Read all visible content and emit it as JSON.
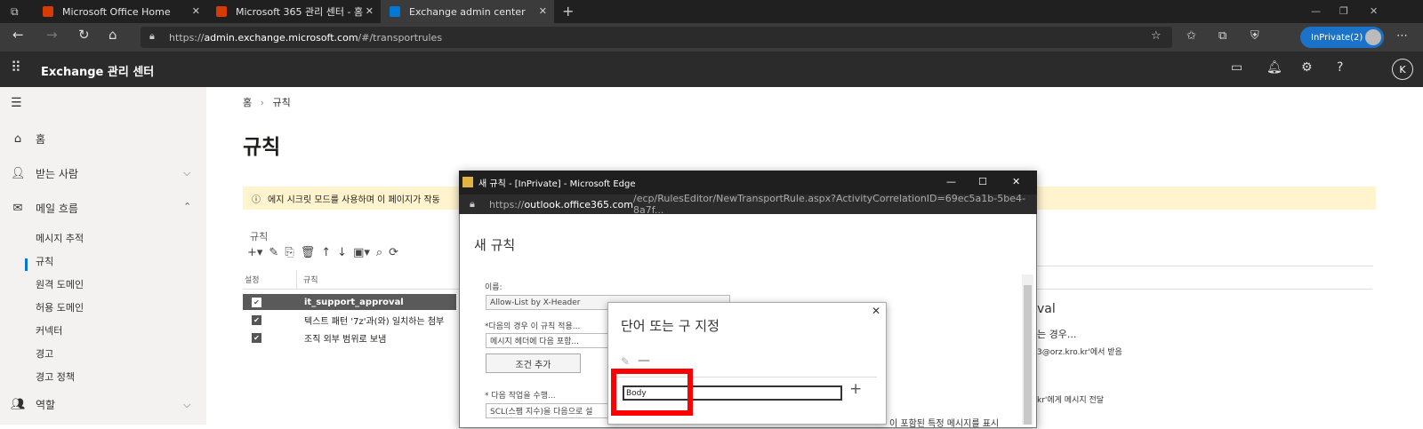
{
  "browser": {
    "tabs": [
      {
        "label": "Microsoft Office Home",
        "color": "#d83b01"
      },
      {
        "label": "Microsoft 365 관리 센터 - 홈",
        "color": "#d83b01"
      },
      {
        "label": "Exchange admin center",
        "color": "#0078d4"
      }
    ],
    "url_prefix": "https://",
    "url_host": "admin.exchange.microsoft.com",
    "url_path": "/#/transportrules",
    "inprivate_label": "InPrivate(2)"
  },
  "app": {
    "title": "Exchange 관리 센터",
    "avatar": "K"
  },
  "sidebar": {
    "items": [
      {
        "label": "홈",
        "icon": "home-icon"
      },
      {
        "label": "받는 사람",
        "icon": "person-icon"
      },
      {
        "label": "메일 흐름",
        "icon": "mail-icon"
      }
    ],
    "subitems": [
      "메시지 추적",
      "규칙",
      "원격 도메인",
      "허용 도메인",
      "커넥터",
      "경고",
      "경고 정책"
    ],
    "bottom_item": {
      "label": "역할",
      "icon": "roles-icon"
    }
  },
  "main": {
    "breadcrumb": {
      "home": "홈",
      "current": "규칙"
    },
    "title": "규칙",
    "notice": "에지 시크릿 모드를 사용하며 이 페이지가 작동",
    "rules_label": "규칙",
    "table_headers": {
      "enabled": "설정",
      "rule": "규칙"
    },
    "rows": [
      {
        "name": "it_support_approval",
        "selected": true
      },
      {
        "name": "텍스트 패턴 '7z'과(와) 일치하는 첨부"
      },
      {
        "name": "조직 외부 범위로 보냄"
      }
    ],
    "right_panel": {
      "title": "val",
      "line1": "는 경우...",
      "line2": "3@orz.kro.kr'에서 받음",
      "line3": "kr'에게 메시지 전달",
      "line4": "이 포함된 특정 메시지를 표시"
    }
  },
  "dialog": {
    "window_title": "새 규칙 - [InPrivate] - Microsoft Edge",
    "url_prefix": "https://",
    "url_host": "outlook.office365.com",
    "url_path": "/ecp/RulesEditor/NewTransportRule.aspx?ActivityCorrelationID=69ec5a1b-5be4-8a7f...",
    "heading": "새 규칙",
    "name_label": "이름:",
    "name_value": "Allow-List by X-Header",
    "condition_label": "*다음의 경우 이 규칙 적용...",
    "condition_value": "메시지 헤더에 다음 포함...",
    "add_condition": "조건 추가",
    "action_label": "* 다음 작업을 수행...",
    "action_value": "SCL(스팸 지수)을 다음으로 설"
  },
  "inner_dialog": {
    "title": "단어 또는 구 지정",
    "input_value": "Body",
    "highlight_color": "#ff0000"
  }
}
